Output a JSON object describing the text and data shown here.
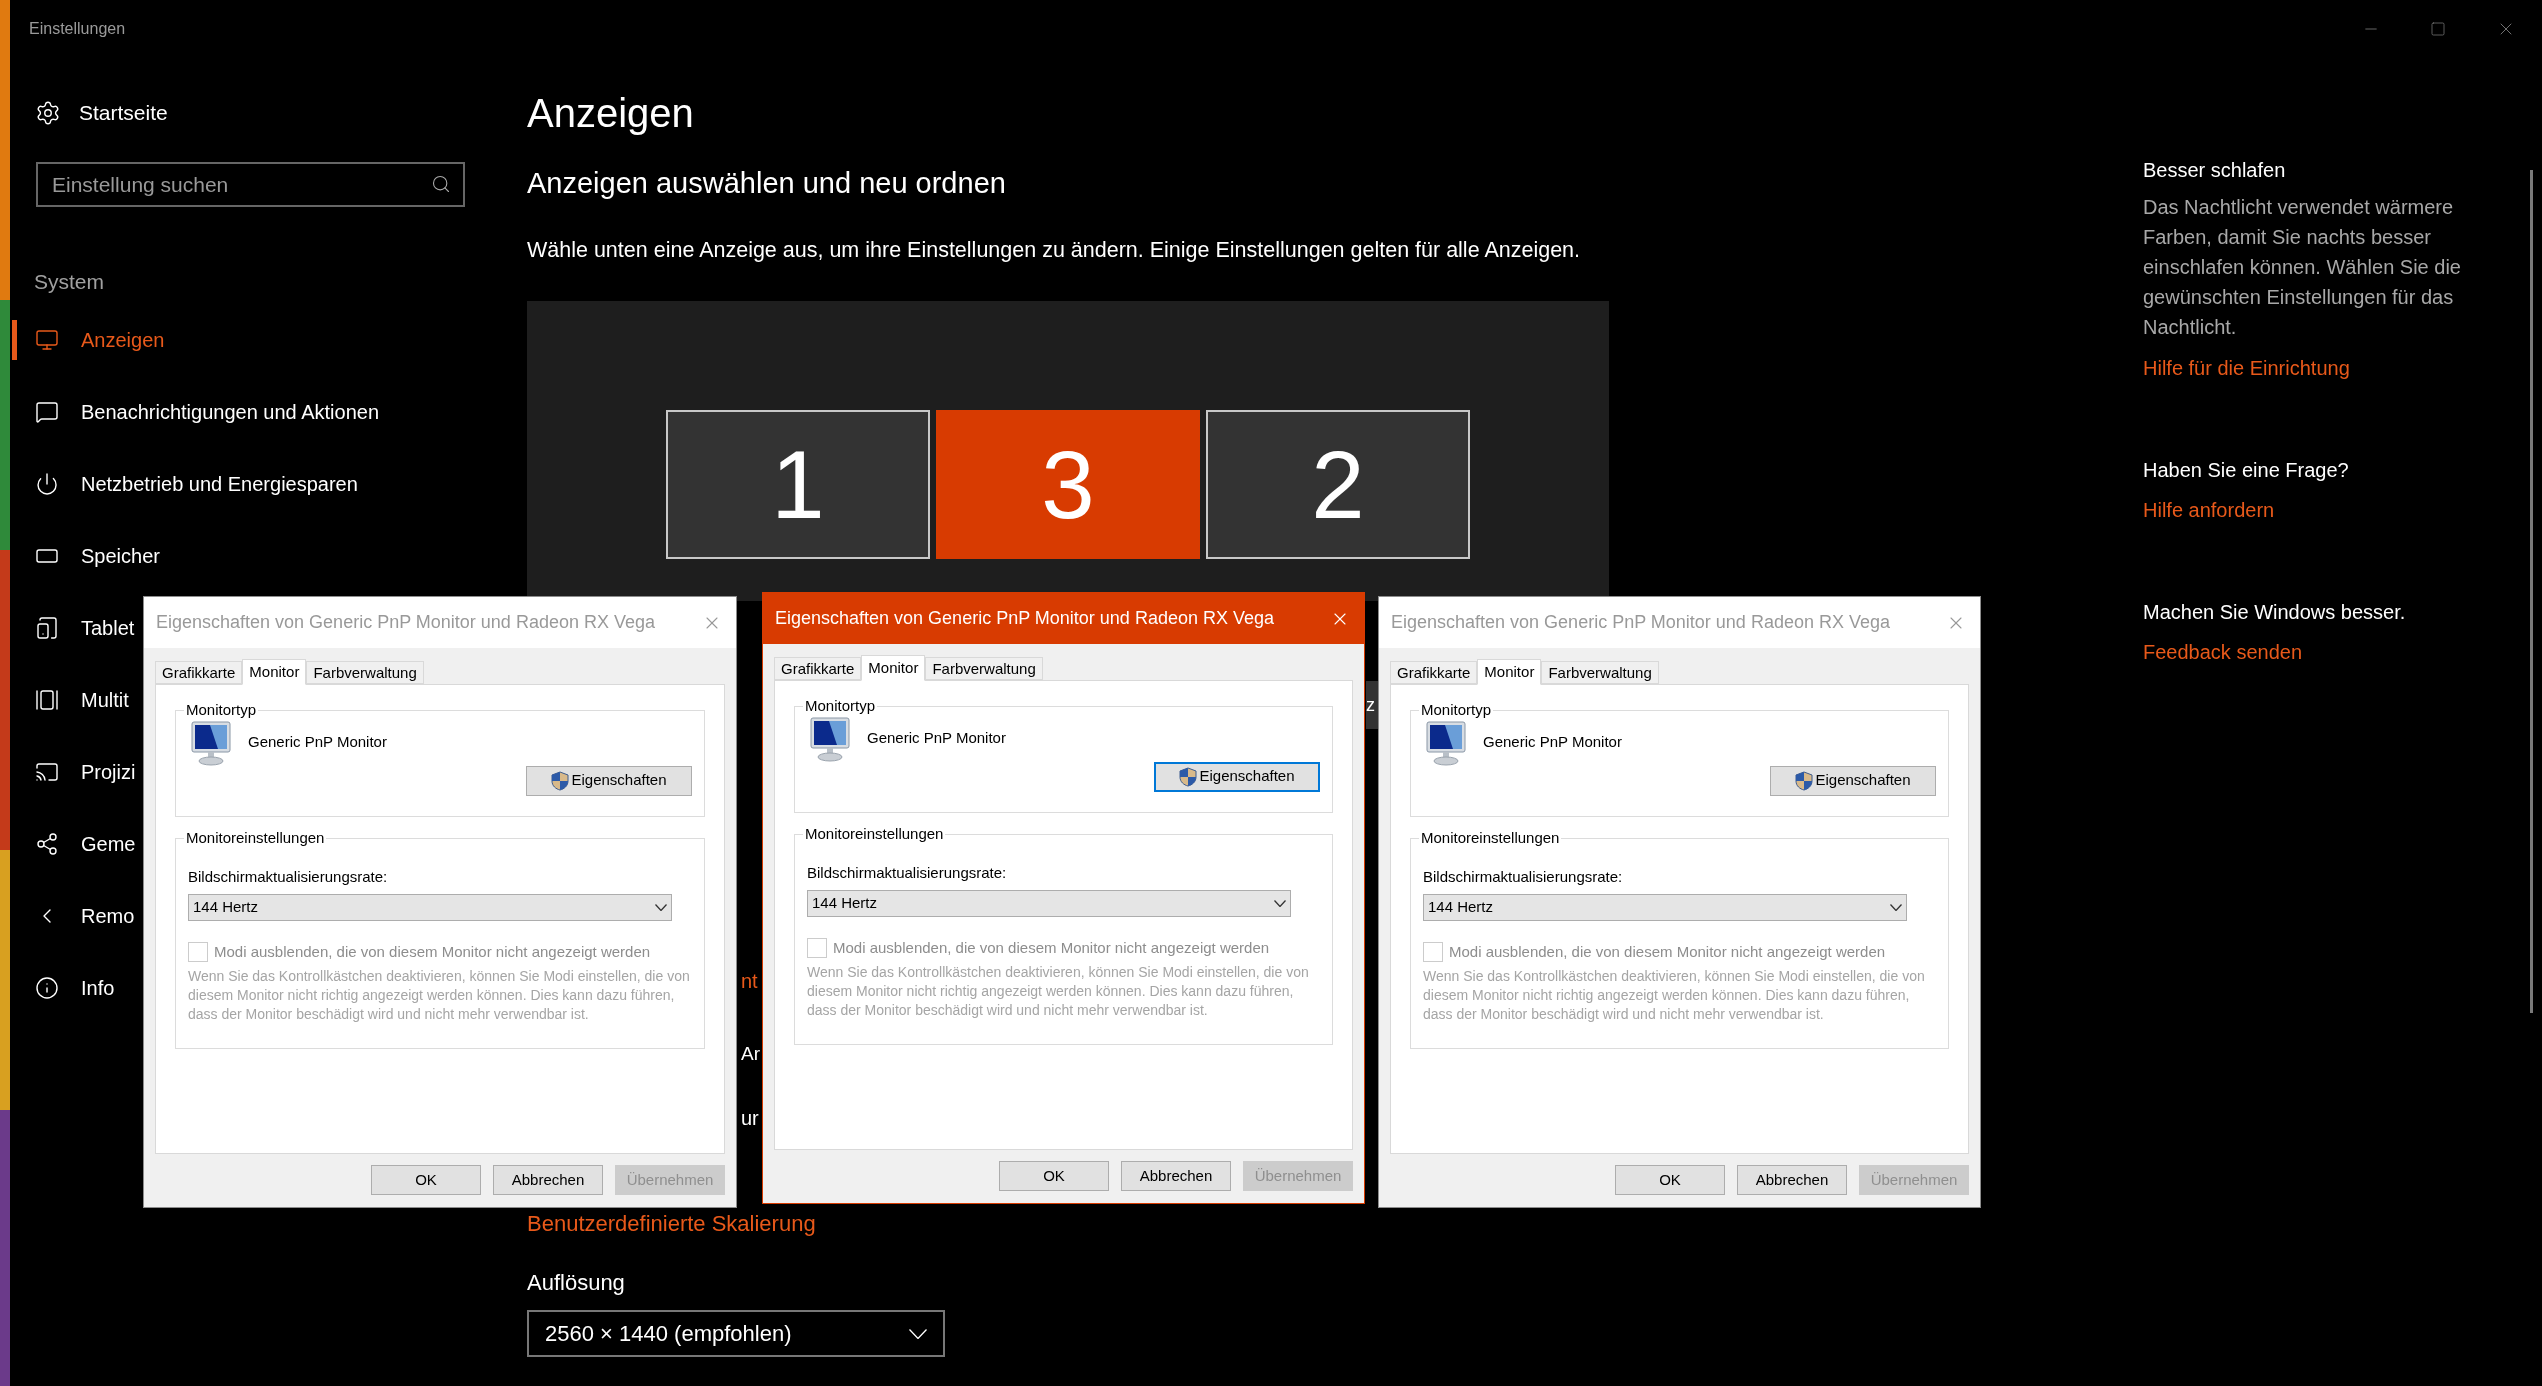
{
  "window": {
    "title": "Einstellungen"
  },
  "sidebar": {
    "home": "Startseite",
    "search": {
      "placeholder": "Einstellung suchen"
    },
    "section": "System",
    "items": [
      {
        "label": "Anzeigen",
        "selected": true
      },
      {
        "label": "Benachrichtigungen und Aktionen",
        "selected": false
      },
      {
        "label": "Netzbetrieb und Energiesparen",
        "selected": false
      },
      {
        "label": "Speicher",
        "selected": false
      },
      {
        "label": "Tablet",
        "selected": false
      },
      {
        "label": "Multit",
        "selected": false
      },
      {
        "label": "Projizi",
        "selected": false
      },
      {
        "label": "Geme",
        "selected": false
      },
      {
        "label": "Remo",
        "selected": false
      },
      {
        "label": "Info",
        "selected": false
      }
    ]
  },
  "page": {
    "title": "Anzeigen",
    "subtitle": "Anzeigen auswählen und neu ordnen",
    "description": "Wähle unten eine Anzeige aus, um ihre Einstellungen zu ändern. Einige Einstellungen gelten für alle Anzeigen.",
    "displays": [
      {
        "label": "1",
        "selected": false
      },
      {
        "label": "3",
        "selected": true
      },
      {
        "label": "2",
        "selected": false
      }
    ],
    "covered_fragments": [
      {
        "text": "z",
        "kind": "button"
      },
      {
        "text": "nt",
        "kind": "link"
      },
      {
        "text": "Ar",
        "kind": "heading"
      },
      {
        "text": "ur",
        "kind": "label"
      }
    ],
    "scaling_link": "Benutzerdefinierte Skalierung",
    "resolution": {
      "label": "Auflösung",
      "value": "2560 × 1440 (empfohlen)"
    }
  },
  "dialogs": [
    {
      "title": "Eigenschaften von Generic PnP Monitor und Radeon RX Vega",
      "active": false,
      "tabs": [
        {
          "label": "Grafikkarte",
          "selected": false
        },
        {
          "label": "Monitor",
          "selected": true
        },
        {
          "label": "Farbverwaltung",
          "selected": false
        }
      ],
      "type_group": "Monitortyp",
      "monitor_name": "Generic PnP Monitor",
      "properties_button": {
        "label": "Eigenschaften",
        "focused": false
      },
      "settings_group": "Monitoreinstellungen",
      "rate_label": "Bildschirmaktualisierungsrate:",
      "rate_value": "144 Hertz",
      "checkbox": {
        "label": "Modi ausblenden, die von diesem Monitor nicht angezeigt werden",
        "checked": false,
        "disabled": true
      },
      "note": "Wenn Sie das Kontrollkästchen deaktivieren, können Sie Modi einstellen, die von diesem Monitor nicht richtig angezeigt werden können. Dies kann dazu führen, dass der Monitor beschädigt wird und nicht mehr verwendbar ist.",
      "buttons": [
        {
          "label": "OK",
          "disabled": false
        },
        {
          "label": "Abbrechen",
          "disabled": false
        },
        {
          "label": "Übernehmen",
          "disabled": true
        }
      ]
    },
    {
      "title": "Eigenschaften von Generic PnP Monitor und Radeon RX Vega",
      "active": true,
      "tabs": [
        {
          "label": "Grafikkarte",
          "selected": false
        },
        {
          "label": "Monitor",
          "selected": true
        },
        {
          "label": "Farbverwaltung",
          "selected": false
        }
      ],
      "type_group": "Monitortyp",
      "monitor_name": "Generic PnP Monitor",
      "properties_button": {
        "label": "Eigenschaften",
        "focused": true
      },
      "settings_group": "Monitoreinstellungen",
      "rate_label": "Bildschirmaktualisierungsrate:",
      "rate_value": "144 Hertz",
      "checkbox": {
        "label": "Modi ausblenden, die von diesem Monitor nicht angezeigt werden",
        "checked": false,
        "disabled": true
      },
      "note": "Wenn Sie das Kontrollkästchen deaktivieren, können Sie Modi einstellen, die von diesem Monitor nicht richtig angezeigt werden können. Dies kann dazu führen, dass der Monitor beschädigt wird und nicht mehr verwendbar ist.",
      "buttons": [
        {
          "label": "OK",
          "disabled": false
        },
        {
          "label": "Abbrechen",
          "disabled": false
        },
        {
          "label": "Übernehmen",
          "disabled": true
        }
      ]
    },
    {
      "title": "Eigenschaften von Generic PnP Monitor und Radeon RX Vega",
      "active": false,
      "tabs": [
        {
          "label": "Grafikkarte",
          "selected": false
        },
        {
          "label": "Monitor",
          "selected": true
        },
        {
          "label": "Farbverwaltung",
          "selected": false
        }
      ],
      "type_group": "Monitortyp",
      "monitor_name": "Generic PnP Monitor",
      "properties_button": {
        "label": "Eigenschaften",
        "focused": false
      },
      "settings_group": "Monitoreinstellungen",
      "rate_label": "Bildschirmaktualisierungsrate:",
      "rate_value": "144 Hertz",
      "checkbox": {
        "label": "Modi ausblenden, die von diesem Monitor nicht angezeigt werden",
        "checked": false,
        "disabled": true
      },
      "note": "Wenn Sie das Kontrollkästchen deaktivieren, können Sie Modi einstellen, die von diesem Monitor nicht richtig angezeigt werden können. Dies kann dazu führen, dass der Monitor beschädigt wird und nicht mehr verwendbar ist.",
      "buttons": [
        {
          "label": "OK",
          "disabled": false
        },
        {
          "label": "Abbrechen",
          "disabled": false
        },
        {
          "label": "Übernehmen",
          "disabled": true
        }
      ]
    }
  ],
  "help_panel": {
    "sections": [
      {
        "heading": "Besser schlafen",
        "text": "Das Nachtlicht verwendet wärmere Farben, damit Sie nachts besser einschlafen können. Wählen Sie die gewünschten Einstellungen für das Nachtlicht.",
        "link": "Hilfe für die Einrichtung"
      },
      {
        "heading": "Haben Sie eine Frage?",
        "link": "Hilfe anfordern"
      },
      {
        "heading": "Machen Sie Windows besser.",
        "link": "Feedback senden"
      }
    ]
  }
}
